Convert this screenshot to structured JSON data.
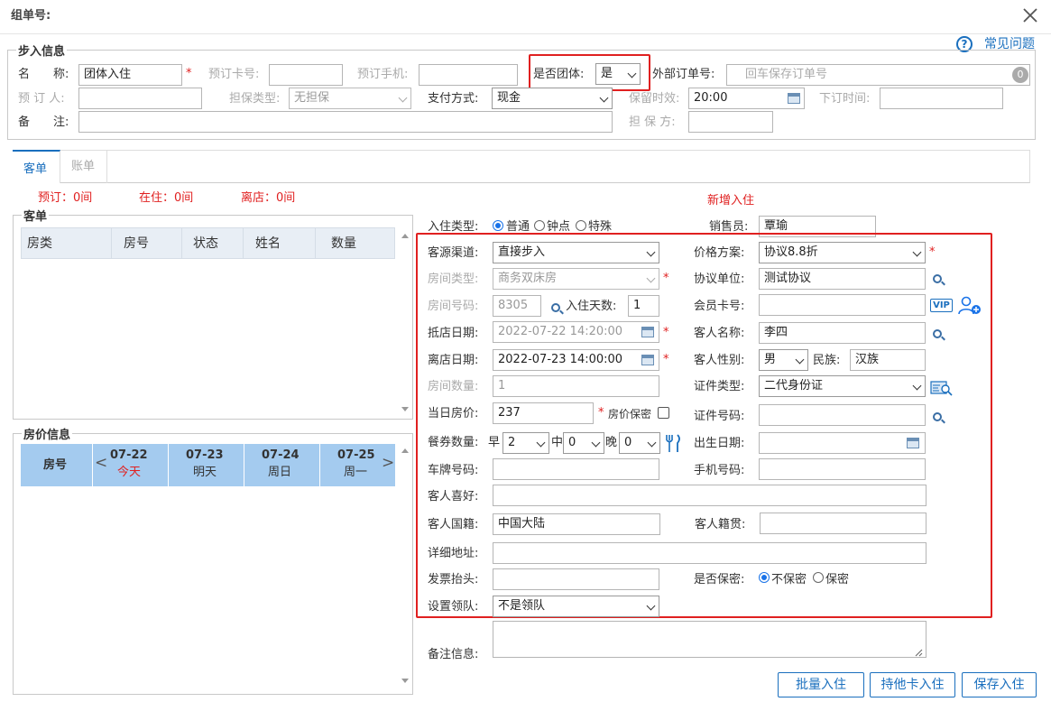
{
  "dialog": {
    "title": "组单号:"
  },
  "help": {
    "label": "常见问题"
  },
  "walkin": {
    "section_title": "步入信息",
    "name_label": "名　　称:",
    "name_value": "团体入住",
    "booking_card_label": "预订卡号:",
    "booking_phone_label": "预订手机:",
    "is_group_label": "是否团体:",
    "is_group_value": "是",
    "ext_order_label": "外部订单号:",
    "ext_order_placeholder": "回车保存订单号",
    "ext_order_badge": "0",
    "booker_label": "预 订 人:",
    "guarantee_type_label": "担保类型:",
    "guarantee_type_value": "无担保",
    "payment_label": "支付方式:",
    "payment_value": "现金",
    "hold_label": "保留时效:",
    "hold_value": "20:00",
    "order_time_label": "下订时间:",
    "remark_label": "备　　注:",
    "guarantor_label": "担 保 方:"
  },
  "tabs": [
    {
      "label": "客单"
    },
    {
      "label": "账单"
    }
  ],
  "summary": {
    "booked": "预订：0间",
    "staying": "在住：0间",
    "left": "离店：0间"
  },
  "guest_list": {
    "title": "客单",
    "columns": [
      "房类",
      "房号",
      "状态",
      "姓名",
      "数量"
    ]
  },
  "room_price": {
    "title": "房价信息",
    "room_no_header": "房号",
    "days": [
      {
        "date": "07-22",
        "label": "今天"
      },
      {
        "date": "07-23",
        "label": "明天"
      },
      {
        "date": "07-24",
        "label": "周日"
      },
      {
        "date": "07-25",
        "label": "周一"
      }
    ]
  },
  "form": {
    "new_checkin_title": "新增入住",
    "checkin_type_label": "入住类型:",
    "checkin_types": [
      "普通",
      "钟点",
      "特殊"
    ],
    "salesperson_label": "销售员:",
    "salesperson_value": "覃瑜",
    "source_label": "客源渠道:",
    "source_value": "直接步入",
    "price_plan_label": "价格方案:",
    "price_plan_value": "协议8.8折",
    "room_type_label": "房间类型:",
    "room_type_value": "商务双床房",
    "agreement_label": "协议单位:",
    "agreement_value": "测试协议",
    "room_no_label": "房间号码:",
    "room_no_value": "8305",
    "days_label": "入住天数:",
    "days_value": "1",
    "member_card_label": "会员卡号:",
    "vip_badge": "VIP",
    "arrive_label": "抵店日期:",
    "arrive_value": "2022-07-22 14:20:00",
    "guest_name_label": "客人名称:",
    "guest_name_value": "李四",
    "leave_label": "离店日期:",
    "leave_value": "2022-07-23 14:00:00",
    "gender_label": "客人性别:",
    "gender_value": "男",
    "ethnic_label": "民族:",
    "ethnic_value": "汉族",
    "room_count_label": "房间数量:",
    "room_count_value": "1",
    "id_type_label": "证件类型:",
    "id_type_value": "二代身份证",
    "daily_price_label": "当日房价:",
    "daily_price_value": "237",
    "price_secret_label": "房价保密",
    "id_no_label": "证件号码:",
    "meal_label": "餐券数量:",
    "breakfast_label": "早",
    "breakfast_value": "2",
    "lunch_label": "中",
    "lunch_value": "0",
    "dinner_label": "晚",
    "dinner_value": "0",
    "birth_label": "出生日期:",
    "plate_label": "车牌号码:",
    "mobile_label": "手机号码:",
    "hobby_label": "客人喜好:",
    "nationality_label": "客人国籍:",
    "nationality_value": "中国大陆",
    "native_label": "客人籍贯:",
    "address_label": "详细地址:",
    "invoice_label": "发票抬头:",
    "secret_label": "是否保密:",
    "secret_options": [
      "不保密",
      "保密"
    ],
    "leader_label": "设置领队:",
    "leader_value": "不是领队",
    "note_label": "备注信息:"
  },
  "buttons": {
    "batch": "批量入住",
    "card": "持他卡入住",
    "save": "保存入住"
  }
}
